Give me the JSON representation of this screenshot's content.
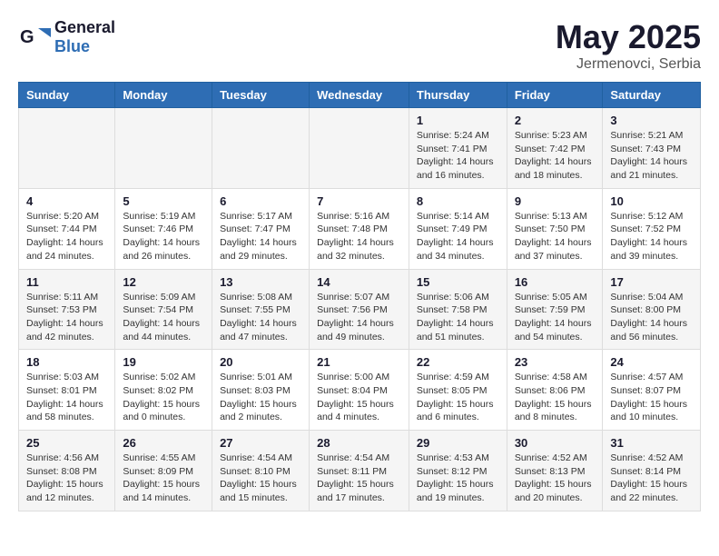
{
  "logo": {
    "text_general": "General",
    "text_blue": "Blue"
  },
  "title": "May 2025",
  "location": "Jermenovci, Serbia",
  "days_of_week": [
    "Sunday",
    "Monday",
    "Tuesday",
    "Wednesday",
    "Thursday",
    "Friday",
    "Saturday"
  ],
  "weeks": [
    [
      {
        "day": "",
        "empty": true
      },
      {
        "day": "",
        "empty": true
      },
      {
        "day": "",
        "empty": true
      },
      {
        "day": "",
        "empty": true
      },
      {
        "day": "1",
        "sunrise": "5:24 AM",
        "sunset": "7:41 PM",
        "daylight": "14 hours and 16 minutes."
      },
      {
        "day": "2",
        "sunrise": "5:23 AM",
        "sunset": "7:42 PM",
        "daylight": "14 hours and 18 minutes."
      },
      {
        "day": "3",
        "sunrise": "5:21 AM",
        "sunset": "7:43 PM",
        "daylight": "14 hours and 21 minutes."
      }
    ],
    [
      {
        "day": "4",
        "sunrise": "5:20 AM",
        "sunset": "7:44 PM",
        "daylight": "14 hours and 24 minutes."
      },
      {
        "day": "5",
        "sunrise": "5:19 AM",
        "sunset": "7:46 PM",
        "daylight": "14 hours and 26 minutes."
      },
      {
        "day": "6",
        "sunrise": "5:17 AM",
        "sunset": "7:47 PM",
        "daylight": "14 hours and 29 minutes."
      },
      {
        "day": "7",
        "sunrise": "5:16 AM",
        "sunset": "7:48 PM",
        "daylight": "14 hours and 32 minutes."
      },
      {
        "day": "8",
        "sunrise": "5:14 AM",
        "sunset": "7:49 PM",
        "daylight": "14 hours and 34 minutes."
      },
      {
        "day": "9",
        "sunrise": "5:13 AM",
        "sunset": "7:50 PM",
        "daylight": "14 hours and 37 minutes."
      },
      {
        "day": "10",
        "sunrise": "5:12 AM",
        "sunset": "7:52 PM",
        "daylight": "14 hours and 39 minutes."
      }
    ],
    [
      {
        "day": "11",
        "sunrise": "5:11 AM",
        "sunset": "7:53 PM",
        "daylight": "14 hours and 42 minutes."
      },
      {
        "day": "12",
        "sunrise": "5:09 AM",
        "sunset": "7:54 PM",
        "daylight": "14 hours and 44 minutes."
      },
      {
        "day": "13",
        "sunrise": "5:08 AM",
        "sunset": "7:55 PM",
        "daylight": "14 hours and 47 minutes."
      },
      {
        "day": "14",
        "sunrise": "5:07 AM",
        "sunset": "7:56 PM",
        "daylight": "14 hours and 49 minutes."
      },
      {
        "day": "15",
        "sunrise": "5:06 AM",
        "sunset": "7:58 PM",
        "daylight": "14 hours and 51 minutes."
      },
      {
        "day": "16",
        "sunrise": "5:05 AM",
        "sunset": "7:59 PM",
        "daylight": "14 hours and 54 minutes."
      },
      {
        "day": "17",
        "sunrise": "5:04 AM",
        "sunset": "8:00 PM",
        "daylight": "14 hours and 56 minutes."
      }
    ],
    [
      {
        "day": "18",
        "sunrise": "5:03 AM",
        "sunset": "8:01 PM",
        "daylight": "14 hours and 58 minutes."
      },
      {
        "day": "19",
        "sunrise": "5:02 AM",
        "sunset": "8:02 PM",
        "daylight": "15 hours and 0 minutes."
      },
      {
        "day": "20",
        "sunrise": "5:01 AM",
        "sunset": "8:03 PM",
        "daylight": "15 hours and 2 minutes."
      },
      {
        "day": "21",
        "sunrise": "5:00 AM",
        "sunset": "8:04 PM",
        "daylight": "15 hours and 4 minutes."
      },
      {
        "day": "22",
        "sunrise": "4:59 AM",
        "sunset": "8:05 PM",
        "daylight": "15 hours and 6 minutes."
      },
      {
        "day": "23",
        "sunrise": "4:58 AM",
        "sunset": "8:06 PM",
        "daylight": "15 hours and 8 minutes."
      },
      {
        "day": "24",
        "sunrise": "4:57 AM",
        "sunset": "8:07 PM",
        "daylight": "15 hours and 10 minutes."
      }
    ],
    [
      {
        "day": "25",
        "sunrise": "4:56 AM",
        "sunset": "8:08 PM",
        "daylight": "15 hours and 12 minutes."
      },
      {
        "day": "26",
        "sunrise": "4:55 AM",
        "sunset": "8:09 PM",
        "daylight": "15 hours and 14 minutes."
      },
      {
        "day": "27",
        "sunrise": "4:54 AM",
        "sunset": "8:10 PM",
        "daylight": "15 hours and 15 minutes."
      },
      {
        "day": "28",
        "sunrise": "4:54 AM",
        "sunset": "8:11 PM",
        "daylight": "15 hours and 17 minutes."
      },
      {
        "day": "29",
        "sunrise": "4:53 AM",
        "sunset": "8:12 PM",
        "daylight": "15 hours and 19 minutes."
      },
      {
        "day": "30",
        "sunrise": "4:52 AM",
        "sunset": "8:13 PM",
        "daylight": "15 hours and 20 minutes."
      },
      {
        "day": "31",
        "sunrise": "4:52 AM",
        "sunset": "8:14 PM",
        "daylight": "15 hours and 22 minutes."
      }
    ]
  ],
  "labels": {
    "sunrise": "Sunrise:",
    "sunset": "Sunset:",
    "daylight": "Daylight:"
  }
}
